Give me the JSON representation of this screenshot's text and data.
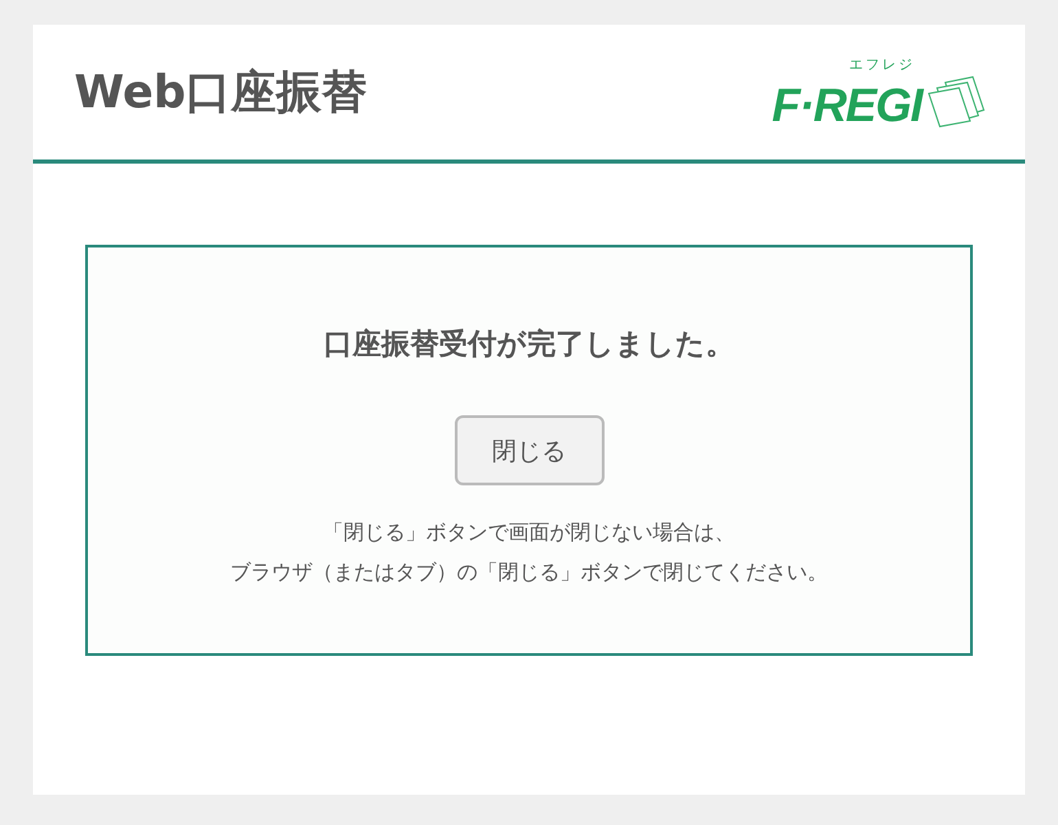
{
  "header": {
    "title": "Web口座振替",
    "logo": {
      "name": "F·REGI",
      "ruby": "エフレジ"
    }
  },
  "message": {
    "title": "口座振替受付が完了しました。",
    "button": "閉じる",
    "notes": [
      "「閉じる」ボタンで画面が閉じない場合は、",
      "ブラウザ（またはタブ）の「閉じる」ボタンで閉じてください。"
    ]
  }
}
